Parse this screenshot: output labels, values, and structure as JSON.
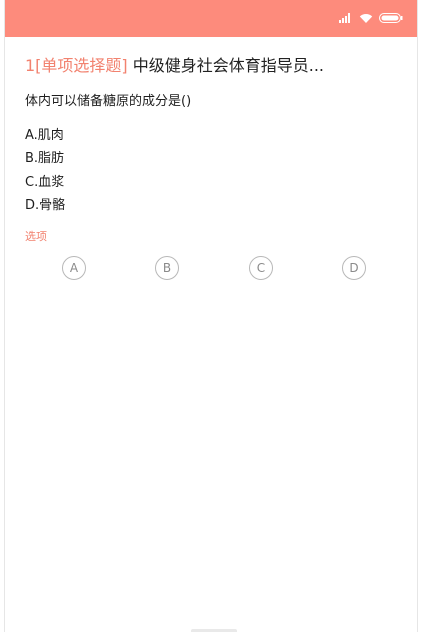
{
  "status_bar": {
    "color": "#fd8b7c",
    "icons": [
      "signal-icon",
      "wifi-icon",
      "battery-icon"
    ]
  },
  "question": {
    "number_and_type": "1[单项选择题]",
    "title": " 中级健身社会体育指导员...",
    "text": "体内可以储备糖原的成分是()"
  },
  "options": [
    "A.肌肉",
    "B.脂肪",
    "C.血浆",
    "D.骨骼"
  ],
  "choices": {
    "label": "选项",
    "buttons": [
      "A",
      "B",
      "C",
      "D"
    ]
  },
  "colors": {
    "accent": "#f2826f",
    "text": "#1e1e1e",
    "choice_border": "#b8b8b8"
  }
}
